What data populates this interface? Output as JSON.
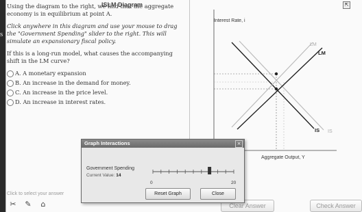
{
  "left_strip_char": "s",
  "question": {
    "p1": "Using the diagram to the right, we find that the aggregate economy is in equilibrium at point A.",
    "p2": "Click anywhere in this diagram and use your mouse to drag the \"Government Spending\" slider to the right. This will simulate an expansionary fiscal policy.",
    "p3": "If this is a long-run model, what causes the accompanying shift in the LM curve?",
    "options": [
      {
        "key": "A",
        "text": "A. A monetary expansion"
      },
      {
        "key": "B",
        "text": "B. An increase in the demand for money."
      },
      {
        "key": "C",
        "text": "C. An increase in the price level."
      },
      {
        "key": "D",
        "text": "D. An increase in interest rates."
      }
    ]
  },
  "graph": {
    "title": "ISLM Diagram",
    "y_label": "Interest Rate, i",
    "x_label": "Aggregate Output, Y",
    "curve_labels": {
      "lm_new": "LM",
      "lm_old": "LM",
      "is_new": "IS",
      "is_old": "IS"
    },
    "icon_glyph": "⇱"
  },
  "dialog": {
    "title": "Graph Interactions",
    "close_glyph": "×",
    "label": "Government Spending",
    "value_prefix": "Current Value:",
    "value": "14",
    "slider": {
      "min": 0,
      "max": 20,
      "value": 14
    },
    "min_label": "0",
    "max_label": "20",
    "reset_label": "Reset Graph",
    "close_label": "Close"
  },
  "footer": {
    "hint": "Click to select your answer",
    "clear_label": "Clear Answer",
    "check_label": "Check Answer",
    "tools": [
      "✂",
      "✎",
      "⌂"
    ]
  }
}
